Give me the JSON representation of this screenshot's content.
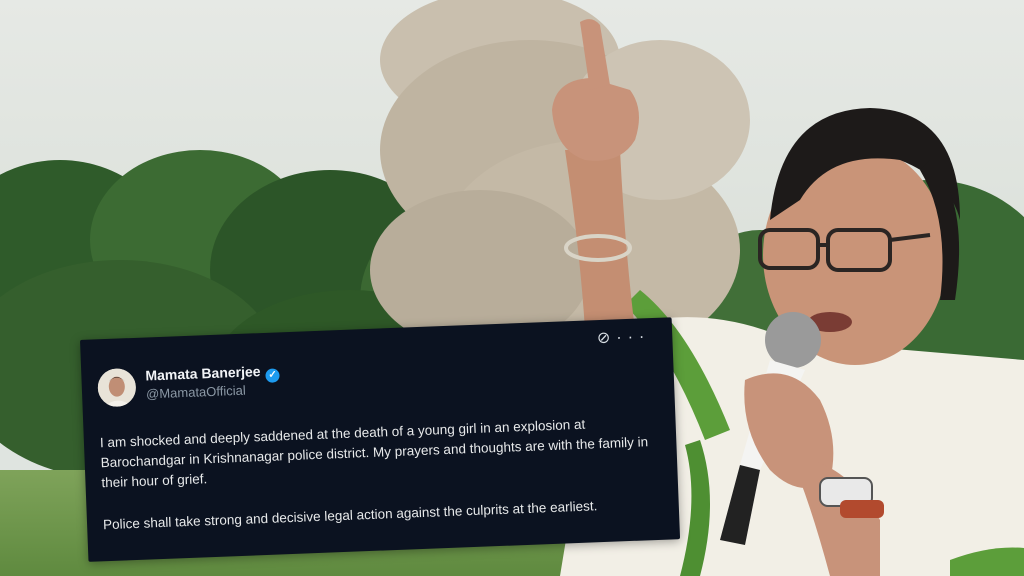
{
  "tweet": {
    "author_name": "Mamata Banerjee",
    "handle": "@MamataOfficial",
    "paragraphs": [
      "I am shocked and deeply saddened at the death of a young girl in an explosion at Barochandgar in Krishnanagar police district. My prayers and thoughts are with the family in their hour of grief.",
      "Police shall take strong and decisive legal action against the culprits at the earliest."
    ],
    "verified_icon": "verified-badge-icon",
    "more_icon": "more-options-icon",
    "grok_icon": "grok-icon"
  },
  "colors": {
    "tweet_background": "#0b1220",
    "verified_blue": "#1d9bf0"
  }
}
